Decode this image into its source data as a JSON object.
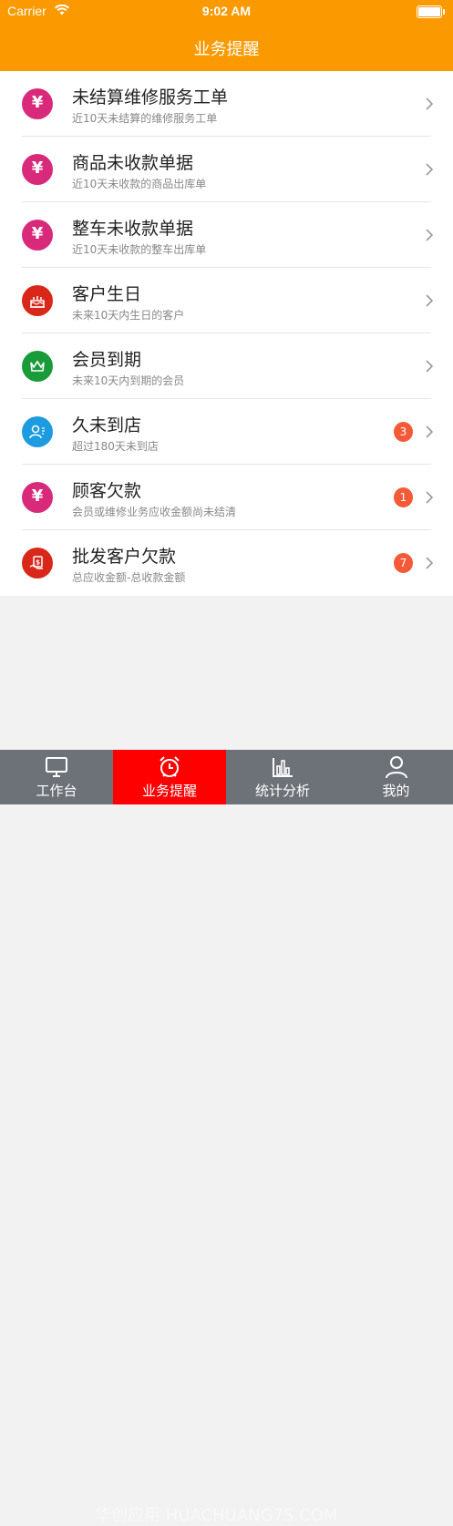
{
  "status_bar": {
    "carrier": "Carrier",
    "time": "9:02 AM"
  },
  "header": {
    "title": "业务提醒"
  },
  "colors": {
    "header": "#fb9900",
    "badge": "#f45a37",
    "tab_active": "#fe0000",
    "tabbar": "#6d7178"
  },
  "list": [
    {
      "icon": "yen-icon",
      "icon_color": "#d9297a",
      "title": "未结算维修服务工单",
      "subtitle": "近10天未结算的维修服务工单",
      "badge": ""
    },
    {
      "icon": "yen-icon",
      "icon_color": "#d9297a",
      "title": "商品未收款单据",
      "subtitle": "近10天未收款的商品出库单",
      "badge": ""
    },
    {
      "icon": "yen-icon",
      "icon_color": "#d9297a",
      "title": "整车未收款单据",
      "subtitle": "近10天未收款的整车出库单",
      "badge": ""
    },
    {
      "icon": "cake-icon",
      "icon_color": "#d9281a",
      "title": "客户生日",
      "subtitle": "未来10天内生日的客户",
      "badge": ""
    },
    {
      "icon": "crown-icon",
      "icon_color": "#1a9b3a",
      "title": "会员到期",
      "subtitle": "未来10天内到期的会员",
      "badge": ""
    },
    {
      "icon": "user-icon",
      "icon_color": "#1d9be0",
      "title": "久未到店",
      "subtitle": "超过180天未到店",
      "badge": "3"
    },
    {
      "icon": "yen-icon",
      "icon_color": "#d9297a",
      "title": "顾客欠款",
      "subtitle": "会员或维修业务应收金额尚未结清",
      "badge": "1"
    },
    {
      "icon": "money-hand-icon",
      "icon_color": "#d9281a",
      "title": "批发客户欠款",
      "subtitle": "总应收金额-总收款金额",
      "badge": "7"
    }
  ],
  "tabs": [
    {
      "label": "工作台",
      "icon": "monitor-icon"
    },
    {
      "label": "业务提醒",
      "icon": "alarm-clock-icon",
      "active": true
    },
    {
      "label": "统计分析",
      "icon": "bar-chart-icon"
    },
    {
      "label": "我的",
      "icon": "person-icon"
    }
  ],
  "watermark": "华创应用 HUACHUANG7S.COM"
}
